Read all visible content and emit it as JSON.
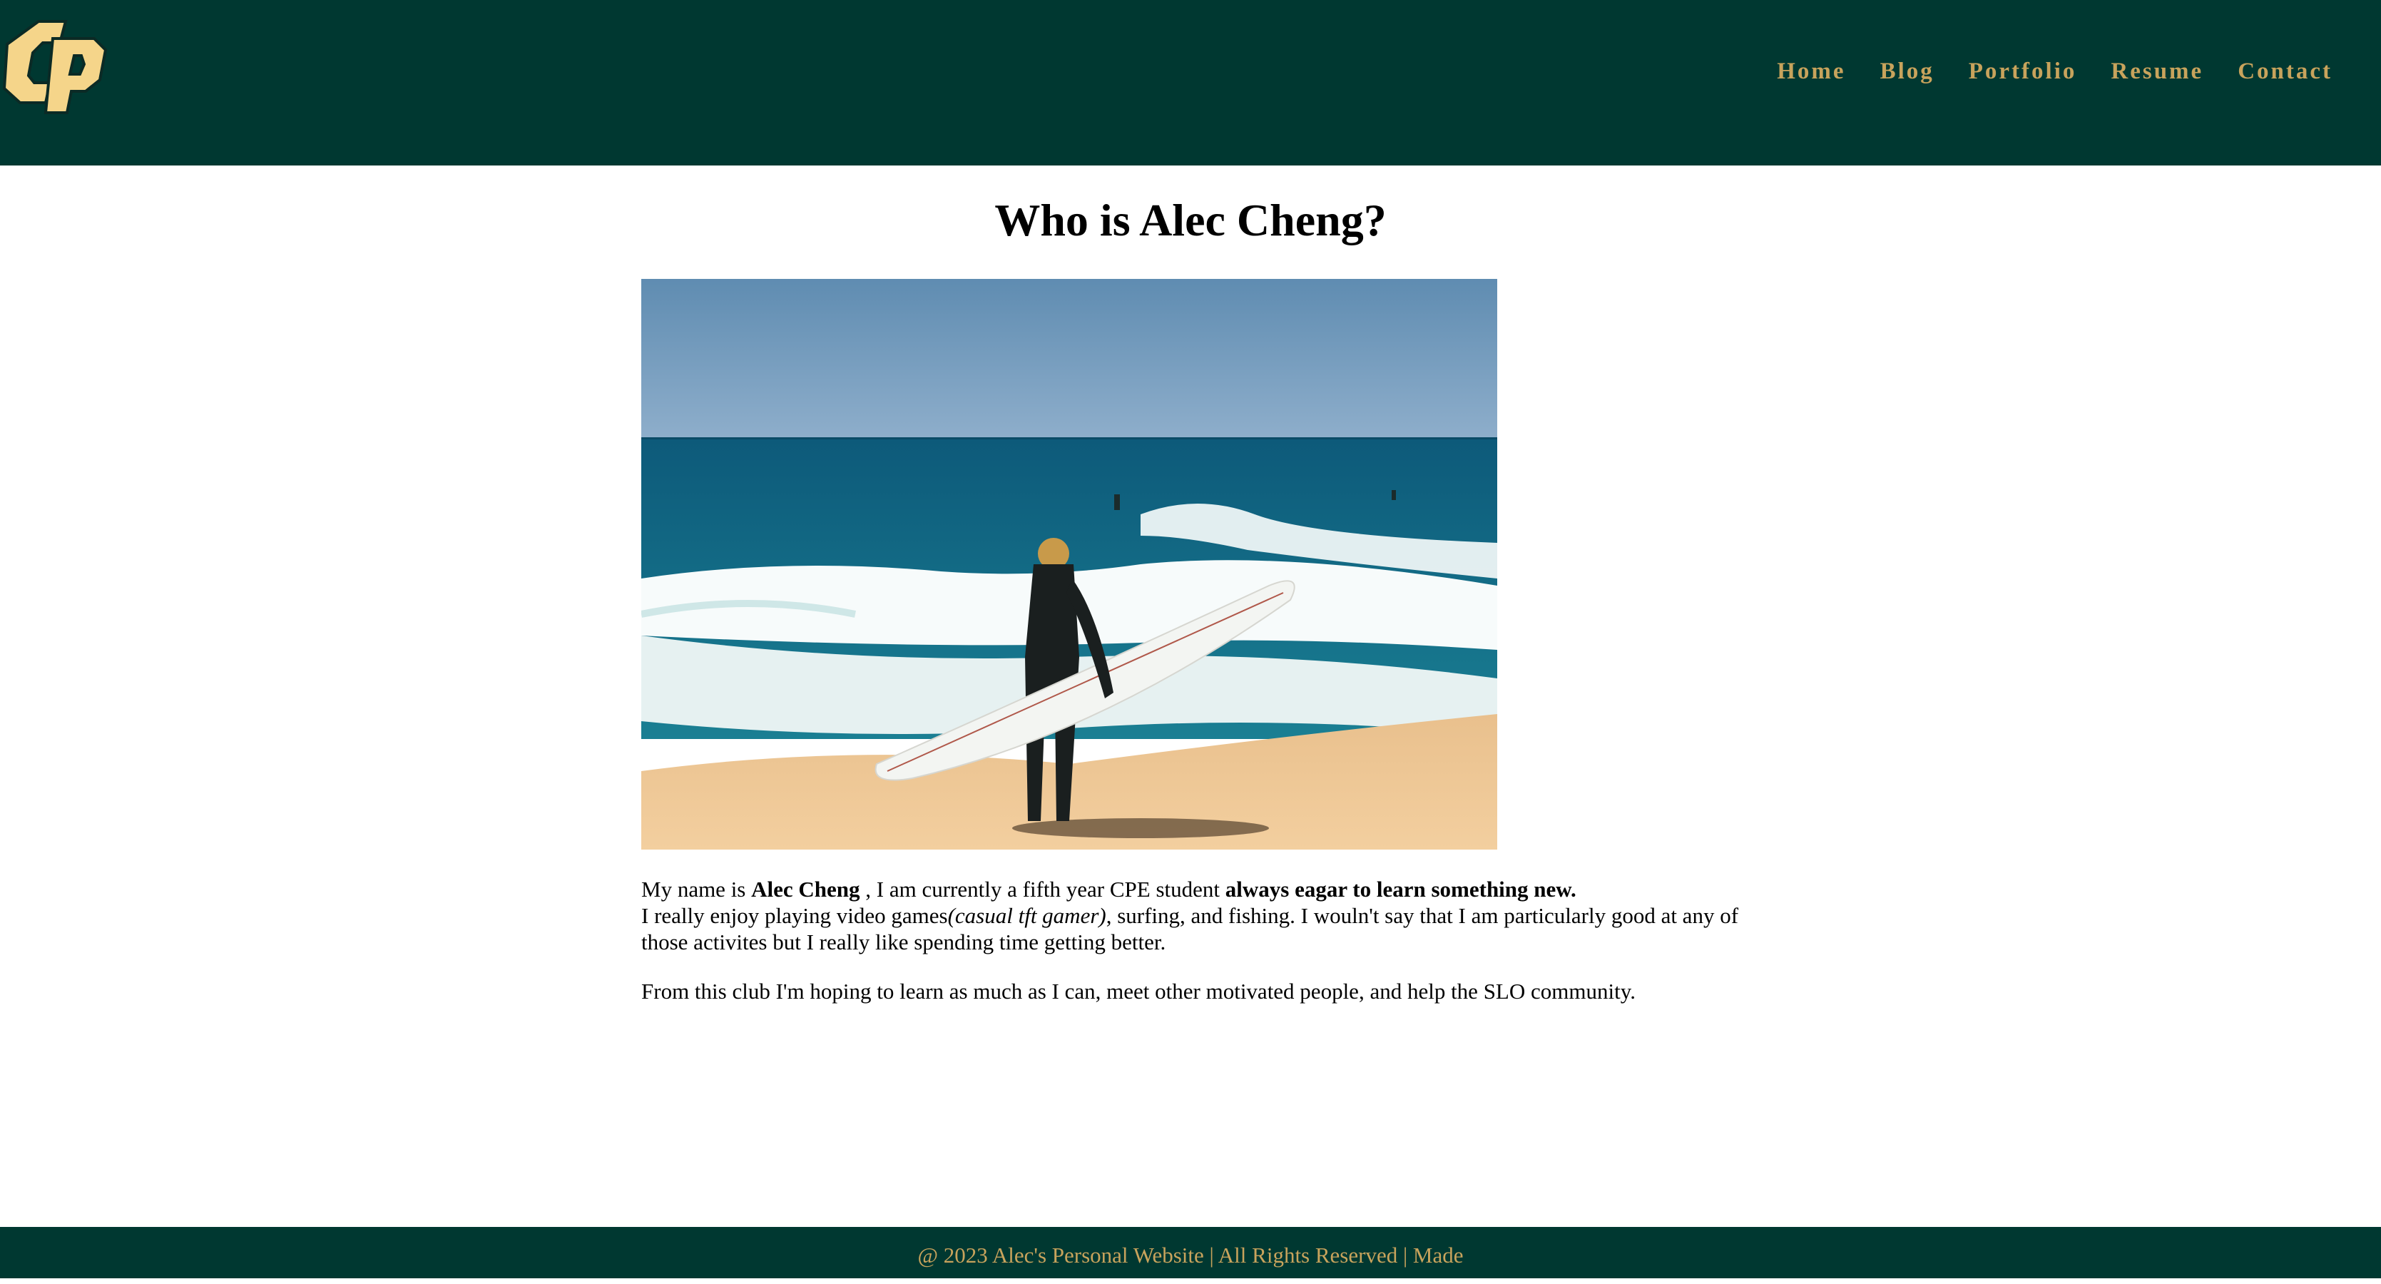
{
  "header": {
    "logo_text": "CP",
    "nav": [
      {
        "label": "Home"
      },
      {
        "label": "Blog"
      },
      {
        "label": "Portfolio"
      },
      {
        "label": "Resume"
      },
      {
        "label": "Contact"
      }
    ]
  },
  "main": {
    "title": "Who is Alec Cheng?",
    "paragraph1": {
      "prefix": "My name is ",
      "name": "Alec Cheng",
      "mid": " , I am currently a fifth year CPE student ",
      "emphasis": "always eagar to learn something new.",
      "line2_prefix": "I really enjoy playing video games",
      "line2_italic": "(casual tft gamer)",
      "line2_suffix": ", surfing, and fishing. I wouln't say that I am particularly good at any of those activites but I really like spending time getting better."
    },
    "paragraph2": "From this club I'm hoping to learn as much as I can, meet other motivated people, and help the SLO community."
  },
  "footer": {
    "text": "@ 2023 Alec's Personal Website | All Rights Reserved | Made"
  },
  "colors": {
    "brand_green": "#003831",
    "brand_gold": "#c8a35c"
  }
}
